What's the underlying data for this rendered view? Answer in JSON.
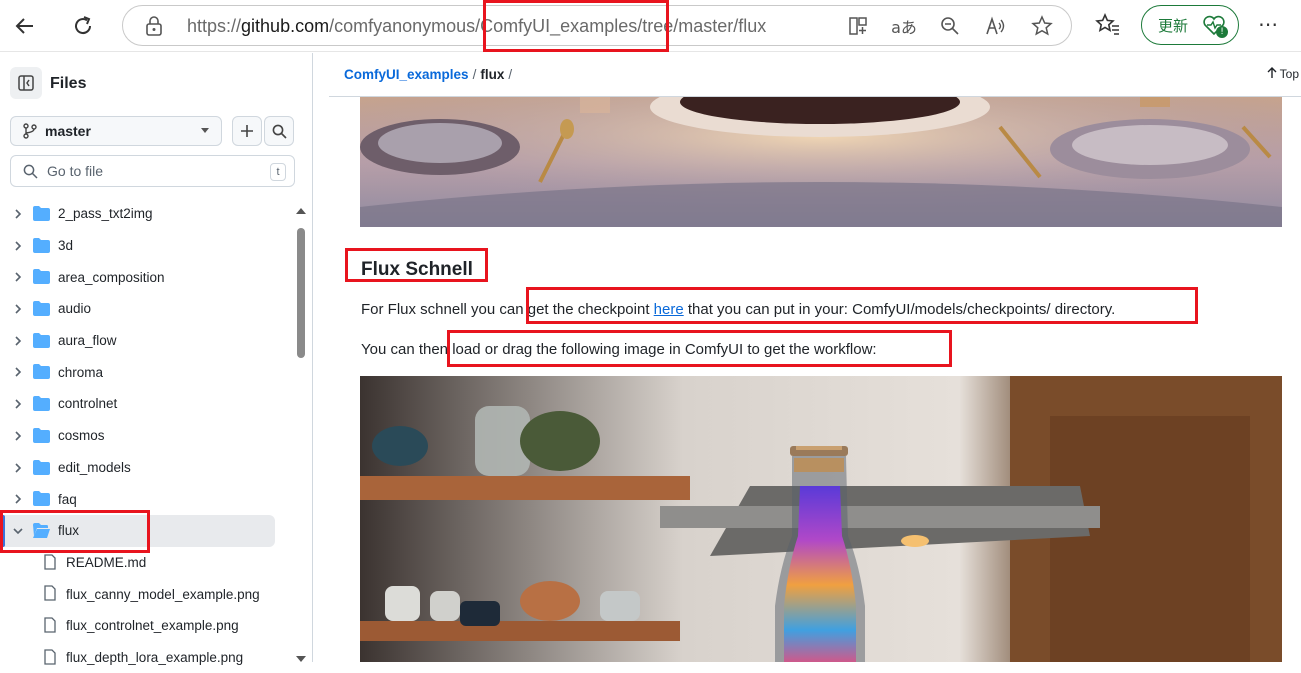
{
  "browser": {
    "back_label": "←",
    "reload_label": "⟳",
    "url_prefix": "https://",
    "url_host": "github.com",
    "url_path": "/comfyanonymous/ComfyUI_examples/tree/master/flux",
    "update_label": "更新",
    "more_label": "⋯",
    "icons": [
      "split-screen-icon",
      "translate-icon",
      "zoom-out-icon",
      "read-aloud-icon",
      "favorite-star-icon"
    ]
  },
  "sidebar": {
    "title": "Files",
    "branch": "master",
    "goto_placeholder": "Go to file",
    "goto_shortcut": "t",
    "folders": [
      {
        "label": "2_pass_txt2img"
      },
      {
        "label": "3d"
      },
      {
        "label": "area_composition"
      },
      {
        "label": "audio"
      },
      {
        "label": "aura_flow"
      },
      {
        "label": "chroma"
      },
      {
        "label": "controlnet"
      },
      {
        "label": "cosmos"
      },
      {
        "label": "edit_models"
      },
      {
        "label": "faq"
      },
      {
        "label": "flux"
      }
    ],
    "files": [
      {
        "label": "README.md"
      },
      {
        "label": "flux_canny_model_example.png"
      },
      {
        "label": "flux_controlnet_example.png"
      },
      {
        "label": "flux_depth_lora_example.png"
      }
    ]
  },
  "main": {
    "breadcrumb_repo": "ComfyUI_examples",
    "breadcrumb_sep1": "/",
    "breadcrumb_dir": "flux",
    "breadcrumb_sep2": "/",
    "top_label": "Top",
    "heading": "Flux Schnell",
    "para1_before": "For Flux schnell you can get the checkpoint ",
    "para1_link": "here",
    "para1_after": " that you can put in your: ComfyUI/models/checkpoints/ directory.",
    "para2": "You can then load or drag the following image in ComfyUI to get the workflow:"
  },
  "colors": {
    "highlight": "#e8141e",
    "link": "#0969da",
    "folder": "#54aeff",
    "update_green": "#1d7a3a"
  }
}
